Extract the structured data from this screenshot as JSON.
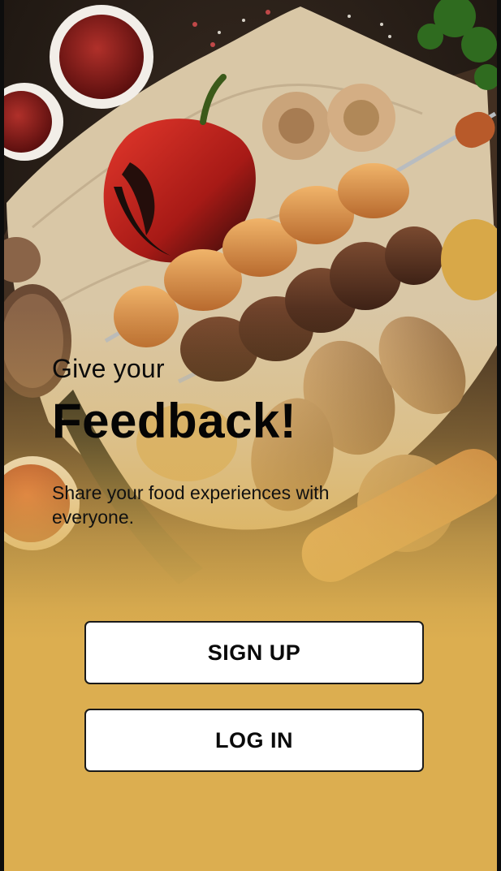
{
  "hero": {
    "eyebrow": "Give your",
    "headline": "Feedback!",
    "tagline": "Share your food experiences with everyone."
  },
  "actions": {
    "signup_label": "SIGN UP",
    "login_label": "LOG IN"
  },
  "colors": {
    "accent_background": "#dcae50",
    "button_background": "#ffffff",
    "text": "#050505"
  }
}
